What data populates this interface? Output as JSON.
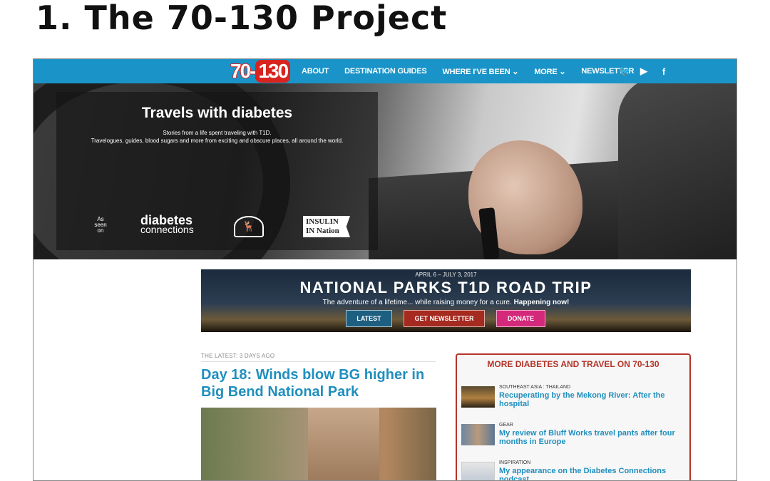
{
  "slide": {
    "title": "1. The 70-130 Project"
  },
  "nav": {
    "logo_part1": "70",
    "logo_part2": "130",
    "items": [
      "ABOUT",
      "DESTINATION GUIDES",
      "WHERE I'VE BEEN ⌄",
      "MORE ⌄",
      "NEWSLETTER"
    ],
    "icons": [
      {
        "name": "twitter-icon",
        "glyph": "🐦"
      },
      {
        "name": "youtube-icon",
        "glyph": "▶"
      },
      {
        "name": "facebook-icon",
        "glyph": "f"
      }
    ]
  },
  "hero": {
    "title": "Travels with diabetes",
    "subtitle_line1": "Stories from a life spent traveling with T1D.",
    "subtitle_line2": "Travelogues, guides, blood sugars and more from exciting and obscure places, all around the world.",
    "as_seen_on": "As seen on",
    "dc_logo_top": "diabetes",
    "dc_logo_bottom": "connections",
    "insulin_logo_top": "INSULIN",
    "insulin_logo_bottom": "IN Nation"
  },
  "banner": {
    "dates": "APRIL 6 – JULY 3, 2017",
    "title": "NATIONAL PARKS T1D ROAD TRIP",
    "subtitle": "The adventure of a lifetime... while raising money for a cure.",
    "subtitle_bold": "Happening now!",
    "btn_latest": "LATEST",
    "btn_newsletter": "GET NEWSLETTER",
    "btn_donate": "DONATE"
  },
  "latest": {
    "label": "THE LATEST: 3 DAYS AGO",
    "title": "Day 18: Winds blow BG higher in Big Bend National Park"
  },
  "sidebar": {
    "title": "MORE DIABETES AND TRAVEL ON 70-130",
    "items": [
      {
        "category": "SOUTHEAST ASIA : THAILAND",
        "title": "Recuperating by the Mekong River: After the hospital"
      },
      {
        "category": "GEAR",
        "title": "My review of Bluff Works travel pants after four months in Europe"
      },
      {
        "category": "INSPIRATION",
        "title": "My appearance on the Diabetes Connections podcast"
      }
    ]
  }
}
